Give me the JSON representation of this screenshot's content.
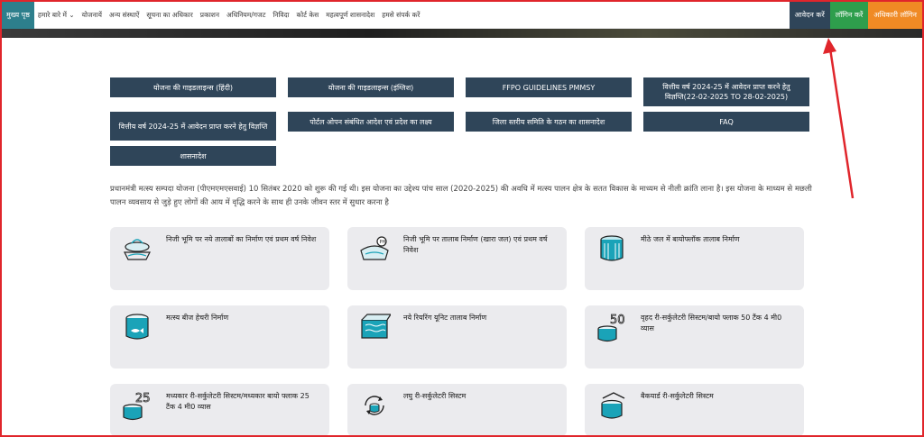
{
  "nav": {
    "home": "मुख्य पृष्ठ",
    "items": [
      "हमारे बारे में ⌄",
      "योजनायें",
      "अन्य संस्थाऐं",
      "सूचना का अधिकार",
      "प्रकाशन",
      "अधिनियम/गजट",
      "निविदा",
      "कोर्ट केस",
      "महत्वपूर्ण शासनादेश",
      "हमसे संपर्क करें"
    ],
    "apply": "आवेदन करें",
    "login": "लॉगिन करें",
    "officer_login": "अधिकारी लॉगिन"
  },
  "links": [
    "योजना की गाइडलाइन्स (हिंदी)",
    "योजना की गाइडलाइन्स (इंग्लिश)",
    "FFPO GUIDELINES PMMSY",
    "वित्तीय वर्ष 2024-25 में आवेदन प्राप्त करने हेतु विज्ञप्ति(22-02-2025 TO 28-02-2025)",
    "वित्तीय वर्ष 2024-25 में आवेदन प्राप्त करने हेतु विज्ञप्ति",
    "पोर्टल ओपन संबंधित आदेश एवं प्रदेश का लक्ष्य",
    "जिला स्तरीय समिति के गठन का शासनादेश",
    "FAQ",
    "शासनादेश"
  ],
  "intro": "प्रधानमंत्री मत्स्य सम्पदा योजना (पीएमएमएसवाई) 10 सितंबर 2020 को शुरू की गई थी। इस योजना का उद्देश्य पांच साल (2020-2025) की अवधि में मत्स्य पालन क्षेत्र के सतत विकास के माध्यम से नीली क्रांति लाना है। इस योजना के माध्यम से मछली पालन व्यवसाय से जुड़े हुए लोगों की आय में वृद्धि करने के साथ ही उनके जीवन स्तर में सुधार करना है",
  "cards": [
    {
      "title": "निजी भूमि पर नये तालाबों का निर्माण एवं प्रथम वर्ष निवेश",
      "icon": "pond-icon"
    },
    {
      "title": "निजी भूमि पर तालाब निर्माण (खारा जल) एवं प्रथम वर्ष निवेश",
      "icon": "brackish-pond-icon"
    },
    {
      "title": "मीठे जल में बायोफ्लॉक तालाब निर्माण",
      "icon": "biofloc-tank-icon"
    },
    {
      "title": "मत्स्य बीज हेचरी निर्माण",
      "icon": "hatchery-tank-icon"
    },
    {
      "title": "नये रियरिंग यूनिट तालाब निर्माण",
      "icon": "rearing-unit-icon"
    },
    {
      "title": "वृहद री-सर्कुलेटरी सिस्टम/बायो फ्लाक 50 टैंक 4 मी0 व्यास",
      "icon": "tank-50-icon",
      "badge": "50"
    },
    {
      "title": "मध्यकार री-सर्कुलेटरी सिस्टम/मध्यकार बायो फ्लाक 25 टैंक 4 मी0 व्यास",
      "icon": "tank-25-icon",
      "badge": "25"
    },
    {
      "title": "लघु री-सर्कुलेटरी सिस्टम",
      "icon": "recirculation-icon"
    },
    {
      "title": "बैकयार्ड री-सर्कुलेटरी सिस्टम",
      "icon": "backyard-tank-icon"
    }
  ],
  "colors": {
    "nav_home": "#2d7f8c",
    "apply": "#2f4559",
    "login": "#2e9e4c",
    "officer": "#f08a24",
    "link_button": "#2f4559",
    "card_bg": "#ebebee",
    "annotation": "#e0252b"
  }
}
